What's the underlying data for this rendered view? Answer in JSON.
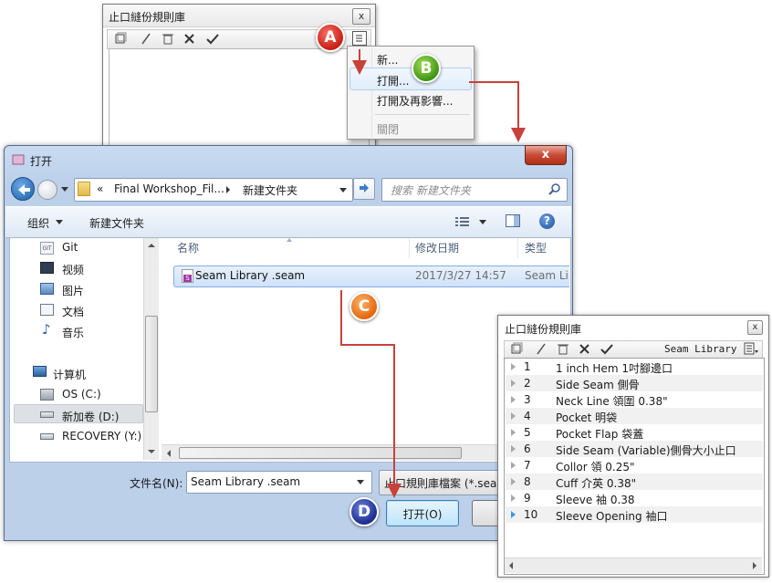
{
  "seam_panel": {
    "title": "止口縫份規則庫",
    "close_label": "x",
    "icons": [
      "new-icon",
      "edit-icon",
      "delete-icon",
      "x-icon",
      "check-icon",
      "menu-icon"
    ]
  },
  "context_menu": {
    "items": [
      "新...",
      "打開...",
      "打開及再影響...",
      "關閉"
    ],
    "highlighted_index": 1,
    "disabled_index": 3
  },
  "open_dialog": {
    "title": "打开",
    "close_label": "x",
    "address": {
      "chevrons": "«",
      "part1": "Final Workshop_Fil...",
      "part2": "新建文件夹"
    },
    "search_placeholder": "搜索 新建文件夹",
    "toolbar": {
      "organize": "组织",
      "new_folder": "新建文件夹"
    },
    "nav": [
      "Git",
      "视频",
      "图片",
      "文档",
      "音乐",
      "计算机",
      "OS (C:)",
      "新加卷 (D:)",
      "RECOVERY (Y:)"
    ],
    "columns": [
      "名称",
      "修改日期",
      "类型"
    ],
    "files": [
      {
        "name": "Seam Library .seam",
        "date": "2017/3/27 14:57",
        "type": "Seam Lib"
      }
    ],
    "filename_label": "文件名(N):",
    "filename_value": "Seam Library .seam",
    "filter_value": "止口規則庫檔案 (*.sean",
    "open_button": "打开(O)"
  },
  "library_panel": {
    "title": "止口縫份規則庫",
    "close_label": "x",
    "toolbar_name": "Seam Library",
    "items": [
      {
        "num": "1",
        "name": "1 inch Hem 1吋腳邊口"
      },
      {
        "num": "2",
        "name": "Side Seam 側骨"
      },
      {
        "num": "3",
        "name": "Neck Line 領圍 0.38\""
      },
      {
        "num": "4",
        "name": "Pocket 明袋"
      },
      {
        "num": "5",
        "name": "Pocket Flap 袋蓋"
      },
      {
        "num": "6",
        "name": "Side Seam (Variable)側骨大小止口"
      },
      {
        "num": "7",
        "name": "Collor 領 0.25\""
      },
      {
        "num": "8",
        "name": "Cuff 介英 0.38\""
      },
      {
        "num": "9",
        "name": "Sleeve 袖 0.38"
      },
      {
        "num": "10",
        "name": "Sleeve Opening 袖口"
      }
    ]
  },
  "callouts": [
    "A",
    "B",
    "C",
    "D"
  ],
  "colors": {
    "callout_a": "#d0261b",
    "callout_b": "#52a81e",
    "callout_c": "#ec7a1f",
    "callout_d": "#1e2f94",
    "arrow": "#c8413a"
  }
}
